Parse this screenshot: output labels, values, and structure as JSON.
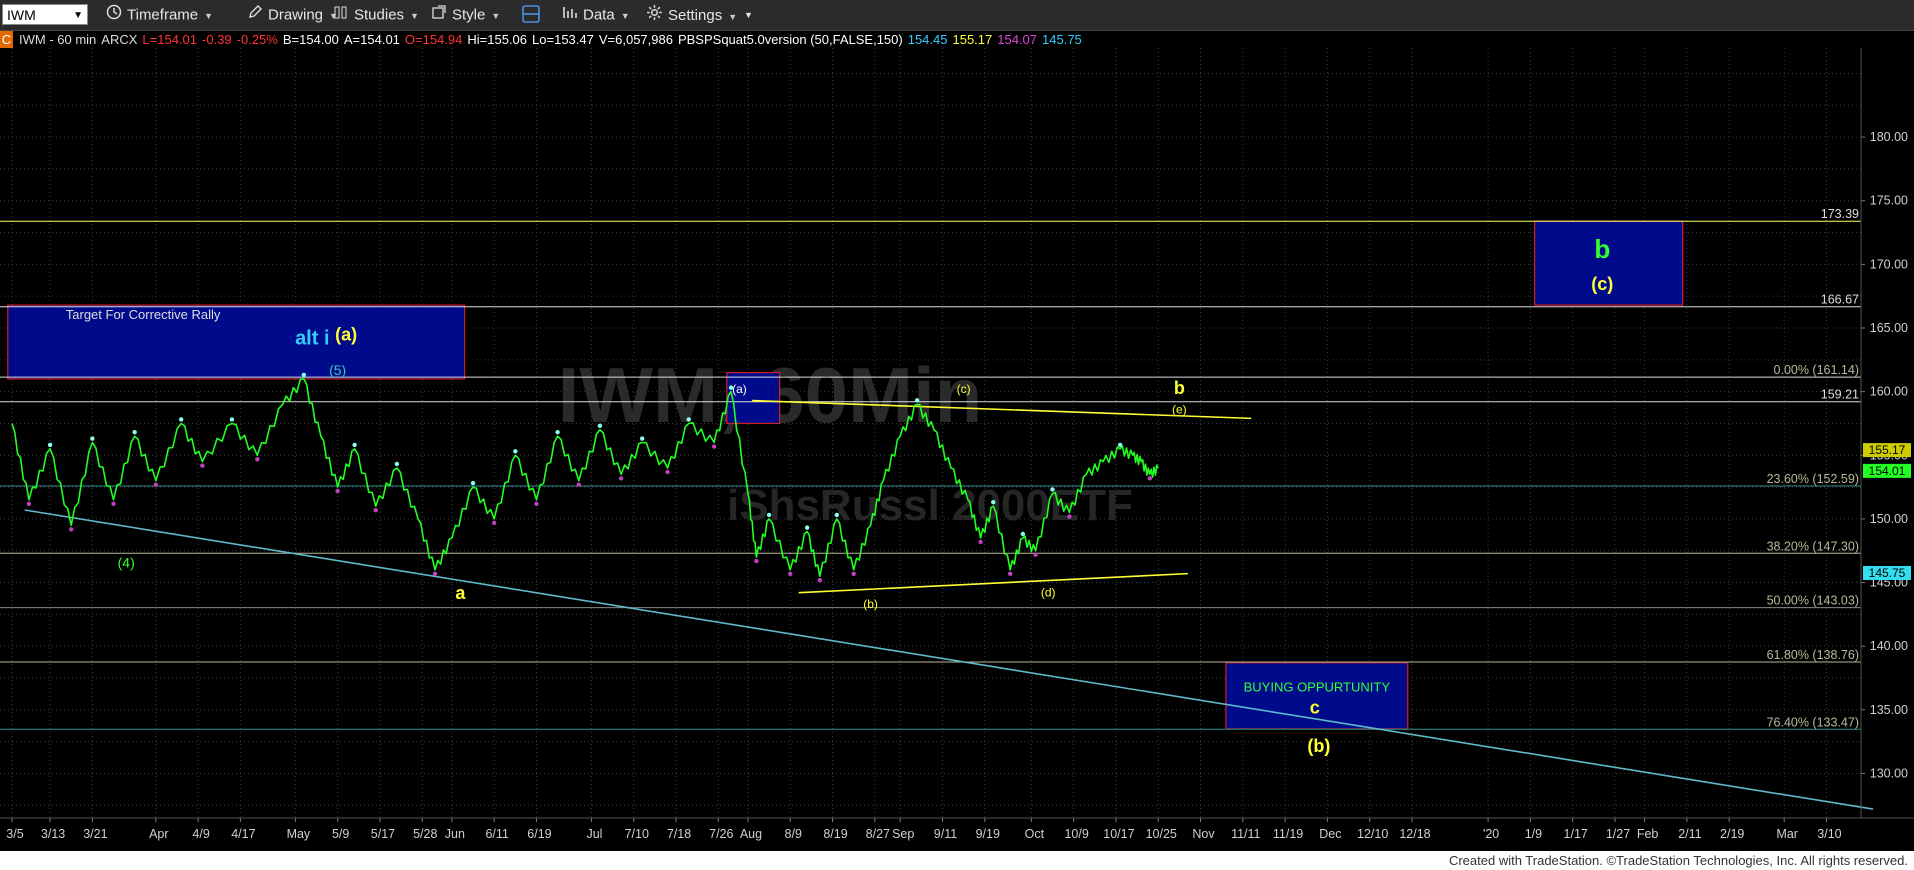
{
  "toolbar": {
    "symbol": "IWM",
    "timeframe_label": "Timeframe",
    "drawing_label": "Drawing",
    "studies_label": "Studies",
    "style_label": "Style",
    "data_label": "Data",
    "settings_label": "Settings"
  },
  "infobar": {
    "badge": "C",
    "title": "IWM - 60 min",
    "exchange": "ARCX",
    "last": "L=154.01",
    "change": "-0.39",
    "change_pct": "-0.25%",
    "bid": "B=154.00",
    "ask": "A=154.01",
    "open": "O=154.94",
    "high": "Hi=155.06",
    "low": "Lo=153.47",
    "volume": "V=6,057,986",
    "study": "PBSPSquat5.0version (50,FALSE,150)",
    "study_vals": [
      "154.45",
      "155.17",
      "154.07",
      "145.75"
    ]
  },
  "colors": {
    "background": "#000000",
    "price_up": "#22ff22",
    "price_down": "#c040c0",
    "fib_line": "#b9b99a",
    "fib_text": "#b9b99a",
    "teal_line": "#5fb9c8",
    "yellow": "#ffff33",
    "box_fill": "#000b8c",
    "box_border": "#cc2222",
    "green_label": "#33ff33",
    "cyan_label": "#33ccff",
    "last_price_bg": "#22ff22",
    "study_cyan_bg": "#33ddee"
  },
  "chart_data": {
    "type": "line",
    "symbol": "IWM",
    "interval": "60 min",
    "ylim": [
      126.5,
      187
    ],
    "grid": true,
    "y_ticks": [
      130,
      135,
      140,
      145,
      150,
      155,
      160,
      165,
      170,
      175,
      180
    ],
    "y_tick_labels": [
      "130.00",
      "135.00",
      "140.00",
      "145.00",
      "150.00",
      "155.00",
      "160.00",
      "165.00",
      "170.00",
      "175.00",
      "180.00"
    ],
    "x_tick_labels": [
      "3/5",
      "3/13",
      "3/21",
      "Apr",
      "4/9",
      "4/17",
      "May",
      "5/9",
      "5/17",
      "5/28",
      "Jun",
      "6/11",
      "6/19",
      "Jul",
      "7/10",
      "7/18",
      "7/26",
      "Aug",
      "8/9",
      "8/19",
      "8/27",
      "Sep",
      "9/11",
      "9/19",
      "Oct",
      "10/9",
      "10/17",
      "10/25",
      "Nov",
      "11/11",
      "11/19",
      "Dec",
      "12/10",
      "12/18",
      "'20",
      "1/9",
      "1/17",
      "1/27",
      "Feb",
      "2/11",
      "2/19",
      "Mar",
      "3/10"
    ],
    "x_tick_index": [
      0,
      9,
      19,
      34,
      44,
      54,
      67,
      77,
      87,
      97,
      104,
      114,
      124,
      137,
      147,
      157,
      167,
      174,
      184,
      194,
      204,
      210,
      220,
      230,
      241,
      251,
      261,
      271,
      281,
      291,
      301,
      311,
      321,
      331,
      349,
      359,
      369,
      379,
      386,
      396,
      406,
      419,
      429
    ],
    "price_series": {
      "name": "",
      "x": [
        0,
        4,
        9,
        14,
        19,
        24,
        29,
        34,
        40,
        45,
        52,
        58,
        64,
        69,
        73,
        77,
        81,
        86,
        91,
        96,
        100,
        104,
        109,
        114,
        119,
        124,
        129,
        134,
        139,
        144,
        149,
        155,
        160,
        166,
        170,
        174,
        176,
        179,
        184,
        188,
        191,
        195,
        199,
        203,
        206,
        210,
        214,
        218,
        222,
        226,
        229,
        232,
        236,
        239,
        242,
        246,
        250,
        254,
        258,
        262,
        265,
        267,
        269,
        271
      ],
      "y": [
        157.5,
        151.5,
        155.5,
        149.5,
        156.0,
        151.5,
        156.5,
        153.0,
        157.5,
        154.5,
        157.5,
        155.0,
        159.0,
        161.0,
        156.5,
        152.5,
        155.5,
        151.0,
        154.0,
        150.0,
        146.0,
        148.5,
        152.5,
        150.0,
        155.0,
        151.5,
        156.5,
        153.0,
        157.0,
        153.5,
        156.0,
        154.0,
        157.5,
        156.0,
        160.0,
        152.0,
        147.0,
        150.0,
        146.0,
        149.0,
        145.5,
        150.0,
        146.0,
        149.5,
        153.0,
        156.5,
        159.0,
        157.0,
        154.0,
        151.5,
        148.5,
        151.0,
        146.0,
        148.5,
        147.5,
        152.0,
        150.5,
        153.5,
        154.5,
        155.5,
        155.0,
        154.5,
        153.5,
        154.0
      ]
    },
    "horizontal_levels": [
      {
        "value": 173.39,
        "label": "173.39",
        "color": "#ffff66"
      },
      {
        "value": 166.67,
        "label": "166.67",
        "color": "#dddddd"
      },
      {
        "value": 161.14,
        "label": "0.00% (161.14)",
        "color": "#dddddd"
      },
      {
        "value": 159.21,
        "label": "159.21",
        "color": "#dddddd"
      },
      {
        "value": 152.59,
        "label": "23.60% (152.59)",
        "color": "#2f8f8f"
      },
      {
        "value": 147.3,
        "label": "38.20% (147.30)",
        "color": "#b9b99a"
      },
      {
        "value": 143.03,
        "label": "50.00% (143.03)",
        "color": "#888888"
      },
      {
        "value": 138.76,
        "label": "61.80% (138.76)",
        "color": "#b9b99a"
      },
      {
        "value": 133.47,
        "label": "76.40% (133.47)",
        "color": "#2f8f8f"
      }
    ],
    "price_tags": [
      {
        "value": 155.17,
        "label": "155.17",
        "bg": "#cccc00",
        "fg": "#000"
      },
      {
        "value": 154.01,
        "label": "154.01",
        "bg": "#22ff22",
        "fg": "#000"
      },
      {
        "value": 145.75,
        "label": "145.75",
        "bg": "#33ddee",
        "fg": "#000"
      }
    ],
    "trendlines": [
      {
        "x1": 3,
        "y1": 150.7,
        "x2": 440,
        "y2": 127.2,
        "color": "#5fb9c8"
      },
      {
        "x1": 175,
        "y1": 159.3,
        "x2": 293,
        "y2": 157.9,
        "color": "#ffff33"
      },
      {
        "x1": 186,
        "y1": 144.2,
        "x2": 278,
        "y2": 145.7,
        "color": "#ffff33"
      }
    ],
    "boxes": [
      {
        "x1": -1,
        "x2": 107,
        "y1": 161.0,
        "y2": 166.8,
        "text": "Target For Corrective Rally",
        "text_color": "#dddddd"
      },
      {
        "x1": 169,
        "x2": 181.5,
        "y1": 157.5,
        "y2": 161.5,
        "text": "",
        "text_color": "#ffffff"
      },
      {
        "x1": 360,
        "x2": 395,
        "y1": 166.8,
        "y2": 173.4,
        "text": "",
        "text_color": "#ffffff"
      },
      {
        "x1": 287,
        "x2": 330,
        "y1": 133.5,
        "y2": 138.7,
        "text": "BUYING OPPURTUNITY",
        "text_color": "#33ff33"
      }
    ],
    "annotations": [
      {
        "text": "alt i",
        "x": 71,
        "y": 163.7,
        "color": "#33ccff",
        "size": 20,
        "bold": true
      },
      {
        "text": "(a)",
        "x": 79,
        "y": 164.0,
        "color": "#ffff33",
        "size": 18,
        "bold": true
      },
      {
        "text": "(5)",
        "x": 77,
        "y": 161.3,
        "color": "#33ccaa",
        "size": 14,
        "bold": false
      },
      {
        "text": "(4)",
        "x": 27,
        "y": 146.2,
        "color": "#33ff33",
        "size": 14,
        "bold": false
      },
      {
        "text": "a",
        "x": 106,
        "y": 143.7,
        "color": "#ffff33",
        "size": 18,
        "bold": true
      },
      {
        "text": "(a)",
        "x": 172,
        "y": 159.9,
        "color": "#ffffff",
        "size": 12,
        "bold": false
      },
      {
        "text": "(b)",
        "x": 203,
        "y": 143.0,
        "color": "#ffff33",
        "size": 12,
        "bold": false
      },
      {
        "text": "(c)",
        "x": 225,
        "y": 159.9,
        "color": "#ffff33",
        "size": 12,
        "bold": false
      },
      {
        "text": "(d)",
        "x": 245,
        "y": 143.9,
        "color": "#ffff33",
        "size": 12,
        "bold": false
      },
      {
        "text": "b",
        "x": 276,
        "y": 159.8,
        "color": "#ffff33",
        "size": 18,
        "bold": true
      },
      {
        "text": "(e)",
        "x": 276,
        "y": 158.3,
        "color": "#ffff33",
        "size": 12,
        "bold": false
      },
      {
        "text": "b",
        "x": 376,
        "y": 170.5,
        "color": "#33ff33",
        "size": 26,
        "bold": true
      },
      {
        "text": "(c)",
        "x": 376,
        "y": 168.0,
        "color": "#ffff33",
        "size": 18,
        "bold": true
      },
      {
        "text": "c",
        "x": 308,
        "y": 134.7,
        "color": "#ffff33",
        "size": 18,
        "bold": true
      },
      {
        "text": "(b)",
        "x": 309,
        "y": 131.7,
        "color": "#ffff33",
        "size": 18,
        "bold": true
      }
    ],
    "watermark": [
      "IWM, 60Min",
      "iShsRussl 2000ETF"
    ]
  },
  "footer": {
    "credit": "Created with TradeStation. ©TradeStation Technologies, Inc. All rights reserved."
  }
}
